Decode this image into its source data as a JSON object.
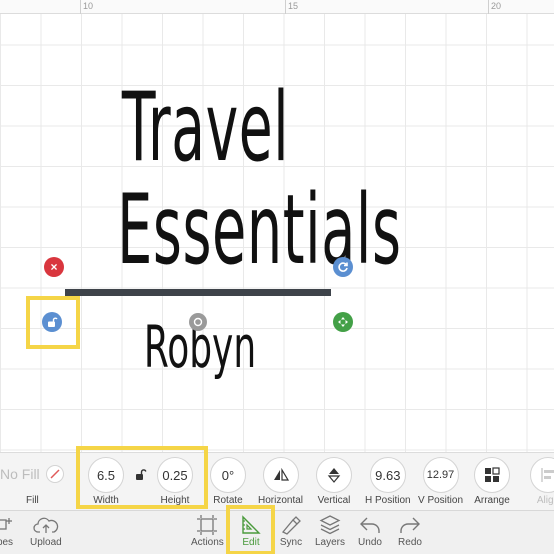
{
  "ruler": {
    "labels": [
      "10",
      "15",
      "20"
    ]
  },
  "canvas": {
    "title_line1": "Travel",
    "title_line2": "Essentials",
    "name": "Robyn"
  },
  "handles": {
    "delete_symbol": "×",
    "rotate_symbol": "↻",
    "lock_symbol": "🔓",
    "resize_symbol": "✥"
  },
  "edit_toolbar": {
    "fill_value": "No Fill",
    "fill_label": "Fill",
    "width_value": "6.5",
    "width_label": "Width",
    "height_value": "0.25",
    "height_label": "Height",
    "rotate_value": "0°",
    "rotate_label": "Rotate",
    "horizontal_label": "Horizontal",
    "vertical_label": "Vertical",
    "hposition_value": "9.63",
    "hposition_label": "H Position",
    "vposition_value": "12.97",
    "vposition_label": "V Position",
    "arrange_label": "Arrange",
    "align_label": "Align"
  },
  "bottom_nav": {
    "shapes_label": "pes",
    "upload_label": "Upload",
    "actions_label": "Actions",
    "edit_label": "Edit",
    "sync_label": "Sync",
    "layers_label": "Layers",
    "undo_label": "Undo",
    "redo_label": "Redo"
  },
  "colors": {
    "highlight": "#f5d547",
    "active_nav": "#4a9a3c",
    "delete_handle": "#d9363e",
    "blue_handle": "#5b8fd1",
    "green_handle": "#43a047"
  }
}
